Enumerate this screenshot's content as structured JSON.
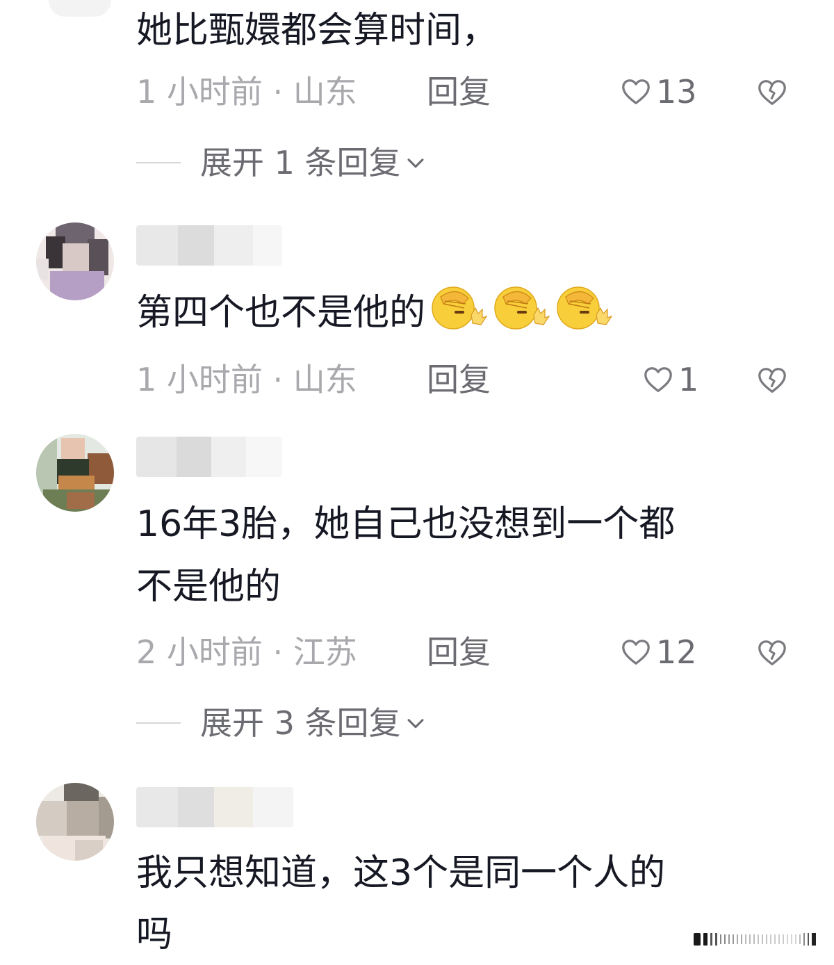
{
  "comments": [
    {
      "text": "她比甄嬛都会算时间，",
      "time_location": "1 小时前 · 山东",
      "reply_label": "回复",
      "likes": "13",
      "expand_label": "展开 1 条回复",
      "avatar_colors": []
    },
    {
      "text": "第四个也不是他的",
      "emoji_count": 3,
      "emoji_name": "facepalm-emoji",
      "time_location": "1 小时前 · 山东",
      "reply_label": "回复",
      "likes": "1",
      "avatar_colors": [
        "#efe8e6",
        "#6e6470",
        "#3a3438",
        "#b59fc4",
        "#d8c9c6",
        "#5a5058"
      ]
    },
    {
      "text_line1": "16年3胎，她自己也没想到一个都",
      "text_line2": "不是他的",
      "time_location": "2 小时前 · 江苏",
      "reply_label": "回复",
      "likes": "12",
      "expand_label": "展开 3 条回复",
      "avatar_colors": [
        "#e4e8e2",
        "#a06d48",
        "#2e3a2c",
        "#c6874a",
        "#6d7e54",
        "#8f5a3a"
      ]
    },
    {
      "text_line1": "我只想知道，这3个是同一个人的",
      "text_line2": "吗",
      "avatar_colors": [
        "#ede9e4",
        "#a39a90",
        "#d4cbc3",
        "#6c6660",
        "#b8ada3",
        "#efe5de"
      ]
    }
  ],
  "icons": {
    "like": "heart-outline-icon",
    "dislike": "broken-heart-icon",
    "expand": "chevron-down-icon"
  },
  "colors": {
    "text": "#161823",
    "meta": "#a8a8ad",
    "secondary": "#6b6b72"
  }
}
